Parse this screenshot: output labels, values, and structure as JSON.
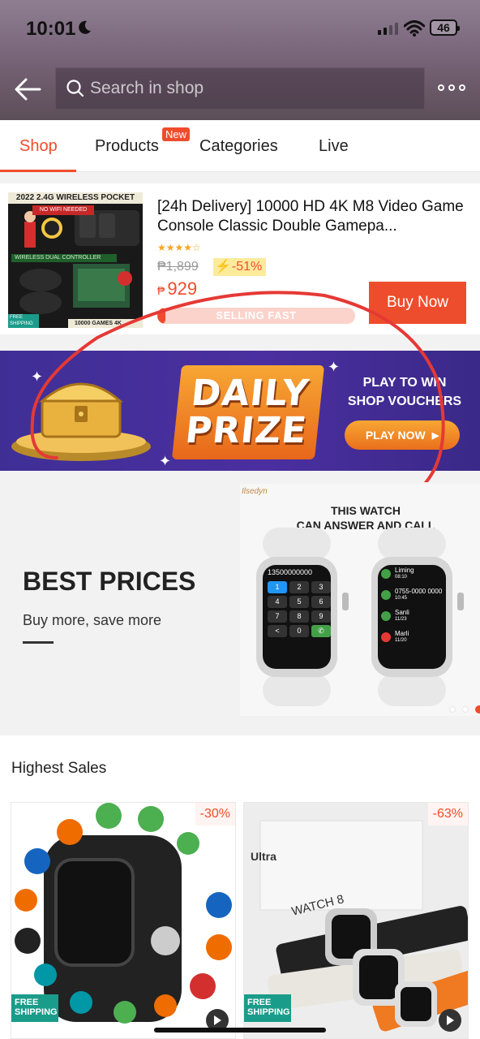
{
  "status_bar": {
    "time": "10:01",
    "battery": "46"
  },
  "header": {
    "search_placeholder": "Search in shop"
  },
  "tabs": [
    {
      "label": "Shop"
    },
    {
      "label": "Products",
      "badge": "New"
    },
    {
      "label": "Categories"
    },
    {
      "label": "Live"
    }
  ],
  "featured_product": {
    "title": "[24h Delivery] 10000 HD 4K M8 Video Game Console Classic Double Gamepa...",
    "stars": "★★★★☆",
    "old_price": "₱1,899",
    "discount": "-51%",
    "price_currency": "₱",
    "price": "929",
    "progress_label": "SELLING FAST",
    "progress_level": 0.04,
    "buy_label": "Buy Now",
    "image_text": {
      "top": "2022 2.4G WIRELESS POCKET",
      "sub": "NO WIFI NEEDED",
      "mid": "WIRELESS DUAL CONTROLLER",
      "free": "FREE SHIPPING",
      "bottom": "10000 GAMES 4K"
    }
  },
  "prize_banner": {
    "title_line1": "DAILY",
    "title_line2": "PRIZE",
    "subtitle_line1": "PLAY TO WIN",
    "subtitle_line2": "SHOP VOUCHERS",
    "button_label": "PLAY NOW"
  },
  "promo": {
    "title": "BEST PRICES",
    "subtitle": "Buy more, save more",
    "watch_caption_line1": "THIS WATCH",
    "watch_caption_line2": "CAN ANSWER AND CALL",
    "brand_mark": "Ilsedyn",
    "dial_number": "13500000000",
    "keypad": [
      "1",
      "2",
      "3",
      "4",
      "5",
      "6",
      "7",
      "8",
      "9",
      "<",
      "0",
      "✆"
    ],
    "contacts": [
      {
        "name": "Liming",
        "time": "08:10"
      },
      {
        "name": "0755-0000 0000",
        "time": "10:45"
      },
      {
        "name": "Sanli",
        "time": "11/23"
      },
      {
        "name": "Marli",
        "time": "11/20"
      }
    ]
  },
  "highest_sales": {
    "title": "Highest Sales",
    "items": [
      {
        "discount": "-30%",
        "free_shipping": "FREE SHIPPING"
      },
      {
        "discount": "-63%",
        "free_shipping": "FREE SHIPPING",
        "box_text": "WATCH 8",
        "box_text_2": "Ultra"
      }
    ]
  },
  "colors": {
    "accent": "#ee4d2d",
    "banner": "#3f2f95"
  }
}
